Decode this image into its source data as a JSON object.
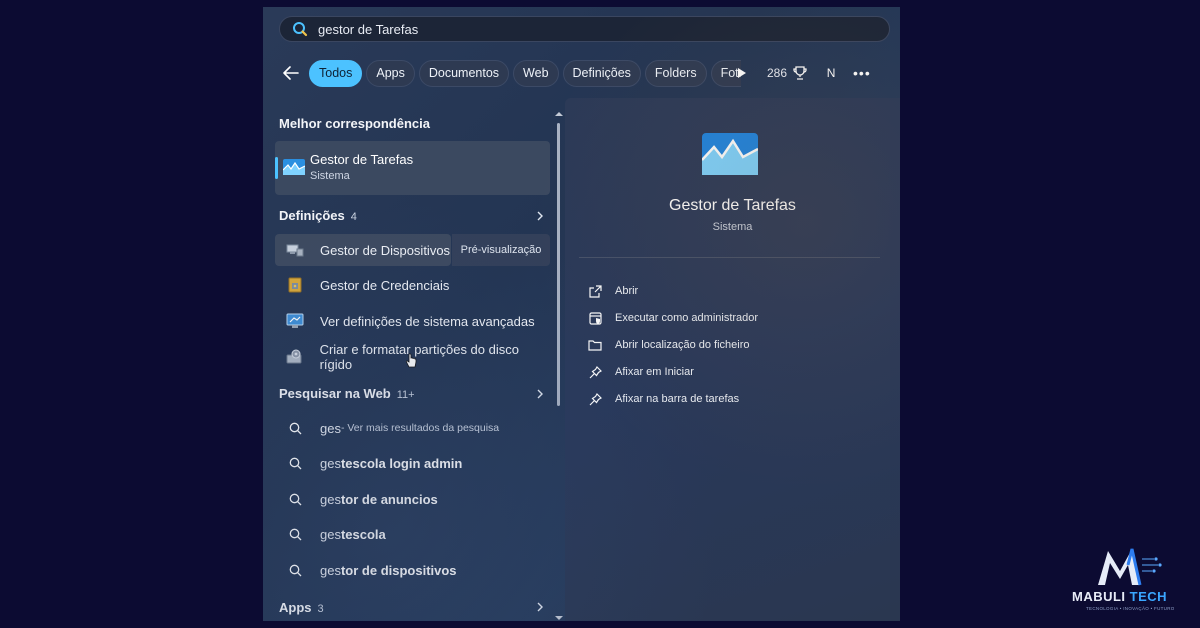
{
  "search": {
    "value": "gestor de Tarefas"
  },
  "filters": [
    "Todos",
    "Apps",
    "Documentos",
    "Web",
    "Definições",
    "Folders",
    "Foto"
  ],
  "toolbar": {
    "points": "286",
    "avatar_letter": "N",
    "more": "•••"
  },
  "best_match": {
    "heading": "Melhor correspondência",
    "title": "Gestor de Tarefas",
    "subtitle": "Sistema"
  },
  "settings": {
    "heading": "Definições",
    "count": "4",
    "items": [
      {
        "label": "Gestor de Dispositivos",
        "preview": "Pré-visualização",
        "icon": "device-manager-icon"
      },
      {
        "label": "Gestor de Credenciais",
        "icon": "credential-manager-icon"
      },
      {
        "label": "Ver definições de sistema avançadas",
        "icon": "system-settings-icon"
      },
      {
        "label": "Criar e formatar partições do disco rígido",
        "icon": "disk-management-icon"
      }
    ]
  },
  "web": {
    "heading": "Pesquisar na Web",
    "count": "11+",
    "items": [
      {
        "pre": "",
        "bold": "ges",
        "post": "",
        "hint": " - Ver mais resultados da pesquisa"
      },
      {
        "pre": "ges",
        "bold": "tescola login admin",
        "post": "",
        "hint": ""
      },
      {
        "pre": "ges",
        "bold": "tor de anuncios",
        "post": "",
        "hint": ""
      },
      {
        "pre": "ges",
        "bold": "tescola",
        "post": "",
        "hint": ""
      },
      {
        "pre": "ges",
        "bold": "tor de dispositivos",
        "post": "",
        "hint": ""
      }
    ]
  },
  "apps": {
    "heading": "Apps",
    "count": "3"
  },
  "detail": {
    "title": "Gestor de Tarefas",
    "subtitle": "Sistema",
    "actions": [
      {
        "label": "Abrir",
        "icon": "open-external-icon"
      },
      {
        "label": "Executar como administrador",
        "icon": "run-as-admin-icon"
      },
      {
        "label": "Abrir localização do ficheiro",
        "icon": "folder-icon"
      },
      {
        "label": "Afixar em Iniciar",
        "icon": "pin-icon"
      },
      {
        "label": "Afixar na barra de tarefas",
        "icon": "pin-icon"
      }
    ]
  },
  "watermark": {
    "brand_a": "MABULI",
    "brand_b": "TECH",
    "tagline": "TECNOLOGIA • INOVAÇÃO • FUTURO"
  },
  "colors": {
    "accent": "#4cc2ff",
    "background": "#0c0b32",
    "panel": "#263b5c"
  }
}
